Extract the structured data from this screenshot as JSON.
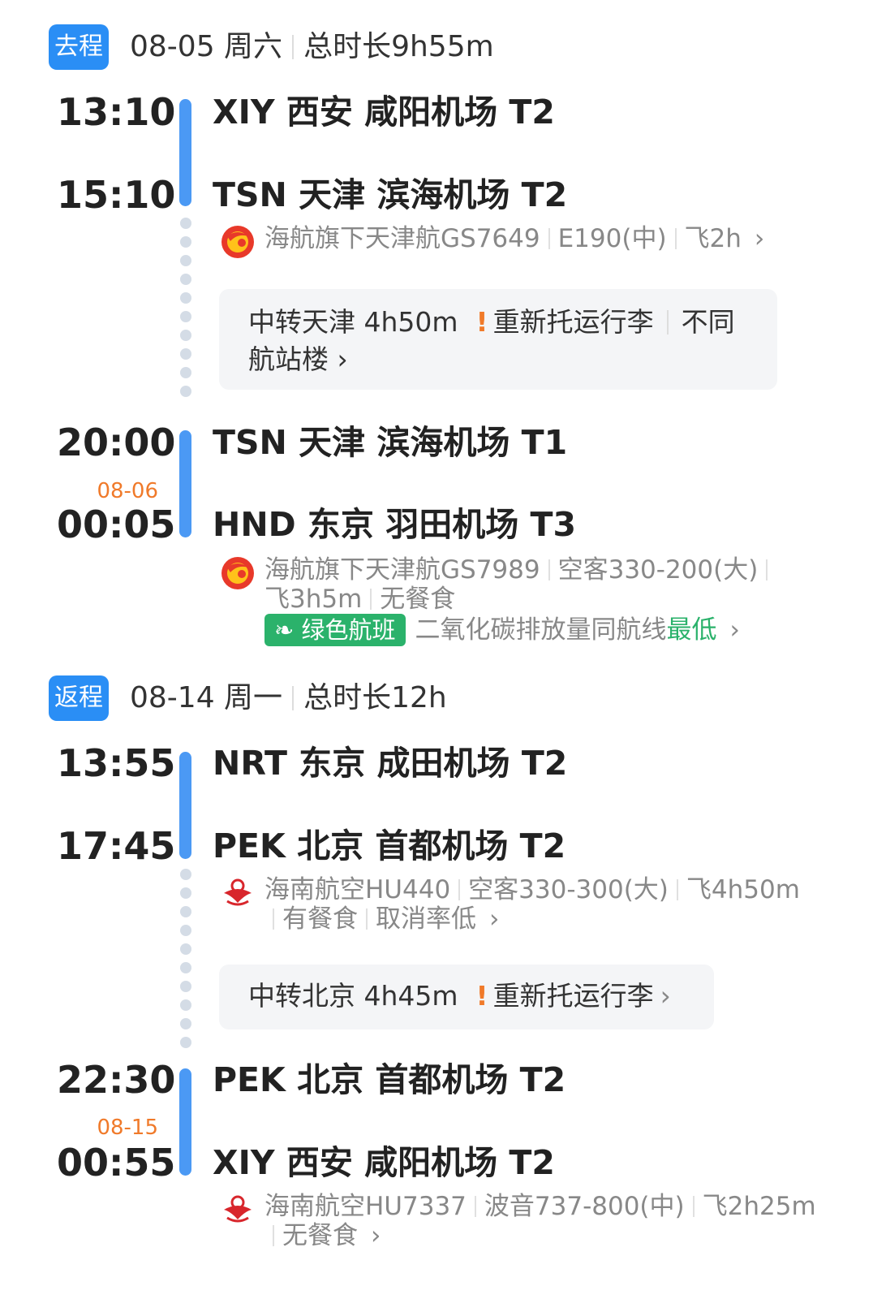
{
  "outbound": {
    "tag": "去程",
    "date": "08-05 周六",
    "total": "总时长9h55m",
    "seg1": {
      "dep_time": "13:10",
      "dep_airport": "XIY 西安 咸阳机场 T2",
      "arr_time": "15:10",
      "arr_airport": "TSN 天津 滨海机场 T2",
      "airline": "海航旗下天津航GS7649",
      "aircraft": "E190(中)",
      "duration": "飞2h"
    },
    "transfer": {
      "text": "中转天津 4h50m",
      "warn_icon": "!",
      "warn": "重新托运行李",
      "note": "不同",
      "note2": "航站楼 ›"
    },
    "seg2": {
      "dep_time": "20:00",
      "dep_airport": "TSN 天津 滨海机场 T1",
      "next_day": "08-06",
      "arr_time": "00:05",
      "arr_airport": "HND 东京 羽田机场 T3",
      "airline": "海航旗下天津航GS7989",
      "aircraft": "空客330-200(大)",
      "duration": "飞3h5m",
      "meal": "无餐食",
      "green_badge": "绿色航班",
      "green_desc": "二氧化碳排放量同航线",
      "green_highlight": "最低"
    }
  },
  "return": {
    "tag": "返程",
    "date": "08-14 周一",
    "total": "总时长12h",
    "seg1": {
      "dep_time": "13:55",
      "dep_airport": "NRT 东京 成田机场 T2",
      "arr_time": "17:45",
      "arr_airport": "PEK 北京 首都机场 T2",
      "airline": "海南航空HU440",
      "aircraft": "空客330-300(大)",
      "duration": "飞4h50m",
      "meal": "有餐食",
      "extra": "取消率低"
    },
    "transfer": {
      "text": "中转北京 4h45m",
      "warn_icon": "!",
      "warn": "重新托运行李"
    },
    "seg2": {
      "dep_time": "22:30",
      "dep_airport": "PEK 北京 首都机场 T2",
      "next_day": "08-15",
      "arr_time": "00:55",
      "arr_airport": "XIY 西安 咸阳机场 T2",
      "airline": "海南航空HU7337",
      "aircraft": "波音737-800(中)",
      "duration": "飞2h25m",
      "meal": "无餐食"
    }
  },
  "icons": {
    "tianjin_logo": "tianjin-airlines-logo",
    "hainan_logo": "hainan-airlines-logo",
    "leaf": "leaf-icon",
    "chevron": "›"
  },
  "colors": {
    "accent": "#2a8ef5",
    "bar": "#4b99f4",
    "warn": "#f07a2a",
    "green": "#2bb26b"
  }
}
